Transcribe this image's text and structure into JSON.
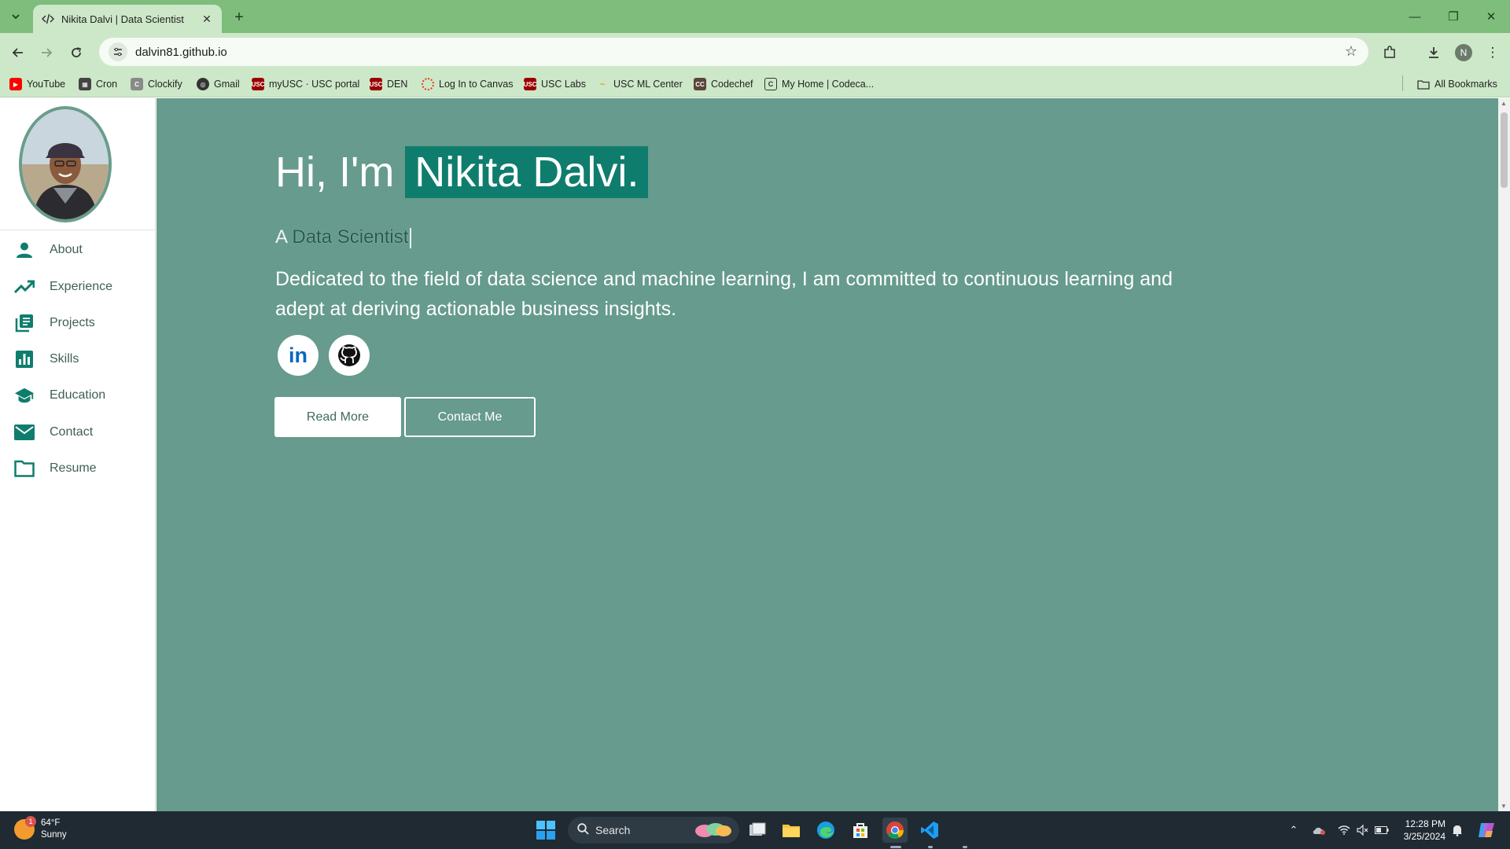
{
  "browser": {
    "tab_title": "Nikita Dalvi | Data Scientist",
    "url": "dalvin81.github.io",
    "profile_initial": "N",
    "bookmarks": [
      {
        "label": "YouTube",
        "color": "#ff0000",
        "glyph": "▶"
      },
      {
        "label": "Cron",
        "color": "#444444",
        "glyph": "▦"
      },
      {
        "label": "Clockify",
        "color": "#8a8a8a",
        "glyph": "C"
      },
      {
        "label": "Gmail",
        "color": "#333333",
        "glyph": "◎"
      },
      {
        "label": "myUSC · USC portal",
        "color": "#990000",
        "glyph": "USC"
      },
      {
        "label": "DEN",
        "color": "#990000",
        "glyph": "USC"
      },
      {
        "label": "Log In to Canvas",
        "color": "#e13b2b",
        "glyph": "◌"
      },
      {
        "label": "USC Labs",
        "color": "#990000",
        "glyph": "USC"
      },
      {
        "label": "USC ML Center",
        "color": "#e8a317",
        "glyph": "~"
      },
      {
        "label": "Codechef",
        "color": "#5b4638",
        "glyph": "CC"
      },
      {
        "label": "My Home | Codeca...",
        "color": "#555555",
        "glyph": "C"
      }
    ],
    "all_bookmarks_label": "All Bookmarks"
  },
  "sidebar": {
    "items": [
      {
        "label": "About",
        "icon": "person-icon"
      },
      {
        "label": "Experience",
        "icon": "trending-up-icon"
      },
      {
        "label": "Projects",
        "icon": "library-books-icon"
      },
      {
        "label": "Skills",
        "icon": "bar-chart-icon"
      },
      {
        "label": "Education",
        "icon": "graduation-cap-icon"
      },
      {
        "label": "Contact",
        "icon": "mail-icon"
      },
      {
        "label": "Resume",
        "icon": "folder-icon"
      }
    ]
  },
  "hero": {
    "greeting": "Hi, I'm",
    "name": "Nikita Dalvi.",
    "role_prefix": "A",
    "role": "Data Scientist",
    "description": "Dedicated to the field of data science and machine learning, I am committed to continuous learning and adept at deriving actionable business insights.",
    "read_more_label": "Read More",
    "contact_label": "Contact Me",
    "linkedin_text": "in"
  },
  "colors": {
    "main_bg": "#669b8d",
    "name_highlight": "#0f7d6d",
    "accent": "#0f7d6d",
    "chrome": "#7ebd7c"
  },
  "taskbar": {
    "weather_temp": "64°F",
    "weather_desc": "Sunny",
    "weather_badge": "1",
    "search_label": "Search",
    "time": "12:28 PM",
    "date": "3/25/2024"
  }
}
